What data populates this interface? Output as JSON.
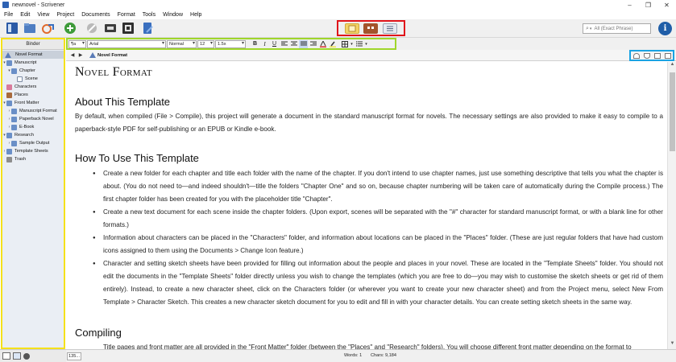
{
  "window": {
    "title": "newnovel - Scrivener",
    "controls": [
      "–",
      "❐",
      "✕"
    ]
  },
  "menubar": [
    "File",
    "Edit",
    "View",
    "Project",
    "Documents",
    "Format",
    "Tools",
    "Window",
    "Help"
  ],
  "search": {
    "placeholder": "All (Exact Phrase)"
  },
  "info_label": "i",
  "binder": {
    "header": "Binder",
    "items": [
      {
        "label": "Novel Format",
        "icon": "novel-format-icon"
      },
      {
        "label": "Manuscript",
        "icon": "manuscript-folder-icon"
      },
      {
        "label": "Chapter",
        "icon": "chapter-folder-icon"
      },
      {
        "label": "Scene",
        "icon": "scene-doc-icon"
      },
      {
        "label": "Characters",
        "icon": "characters-folder-icon"
      },
      {
        "label": "Places",
        "icon": "places-folder-icon"
      },
      {
        "label": "Front Matter",
        "icon": "front-matter-folder-icon"
      },
      {
        "label": "Manuscript Format",
        "icon": "manuscript-format-folder-icon"
      },
      {
        "label": "Paperback Novel",
        "icon": "paperback-novel-folder-icon"
      },
      {
        "label": "E-Book",
        "icon": "ebook-folder-icon"
      },
      {
        "label": "Research",
        "icon": "research-folder-icon"
      },
      {
        "label": "Sample Output",
        "icon": "sample-output-folder-icon"
      },
      {
        "label": "Template Sheets",
        "icon": "template-sheets-folder-icon"
      },
      {
        "label": "Trash",
        "icon": "trash-icon"
      }
    ]
  },
  "formatbar": {
    "style": "¶a",
    "font": "Arial",
    "typeface": "Normal",
    "size": "12",
    "spacing": "1.5x",
    "bold": "B",
    "italic": "I",
    "underline": "U"
  },
  "editor_header": {
    "title": "Novel Format",
    "back": "◀",
    "forward": "▶"
  },
  "document": {
    "title": "Novel Format",
    "sections": [
      {
        "heading": "About This Template",
        "paragraph": "By default, when compiled (File > Compile), this project will generate a document in the standard manuscript format for novels. The necessary settings are also provided to make it easy to compile to a paperback-style PDF for self-publishing or an EPUB or Kindle e-book."
      },
      {
        "heading": "How To Use This Template",
        "bullets": [
          "Create a new folder for each chapter and title each folder with the name of the chapter. If you don't intend to use chapter names, just use something descriptive that tells you what the chapter is about. (You do not need to—and indeed shouldn't—title the folders \"Chapter One\" and so on, because chapter numbering will be taken care of automatically during the Compile process.) The first chapter folder has been created for you with the placeholder title \"Chapter\".",
          "Create a new text document for each scene inside the chapter folders. (Upon export, scenes will be separated with the \"#\" character for standard manuscript format, or with a blank line for other formats.)",
          "Information about characters can be placed in the \"Characters\" folder, and information about locations can be placed in the \"Places\" folder. (These are just regular folders that have had custom icons assigned to them using the Documents > Change Icon feature.)",
          "Character and setting sketch sheets have been provided for filling out information about the people and places in your novel. These are located in the \"Template Sheets\" folder. You should not edit the documents in the \"Template Sheets\" folder directly unless you wish to change the templates (which you are free to do—you may wish to customise the sketch sheets or get rid of them entirely). Instead, to create a new character sheet, click on the Characters folder (or wherever you want to create your new character sheet) and from the Project menu, select New From Template > Character Sketch. This creates a new character sketch document for you to edit and fill in with your character details. You can create setting sketch sheets in the same way."
        ]
      },
      {
        "heading": "Compiling",
        "paragraph": "Title pages and front matter are all provided in the \"Front Matter\" folder (between the \"Places\" and \"Research\" folders). You will choose different front matter depending on the format to"
      }
    ]
  },
  "status": {
    "zoom": "135...",
    "words": "Words: 1",
    "chars": "Chars: 9,184"
  },
  "colors": {
    "view_group_border": "#e0151b",
    "binder_border": "#f5e11a",
    "formatbar_border": "#9fd62a",
    "header_tools_border": "#1aa3e3"
  }
}
